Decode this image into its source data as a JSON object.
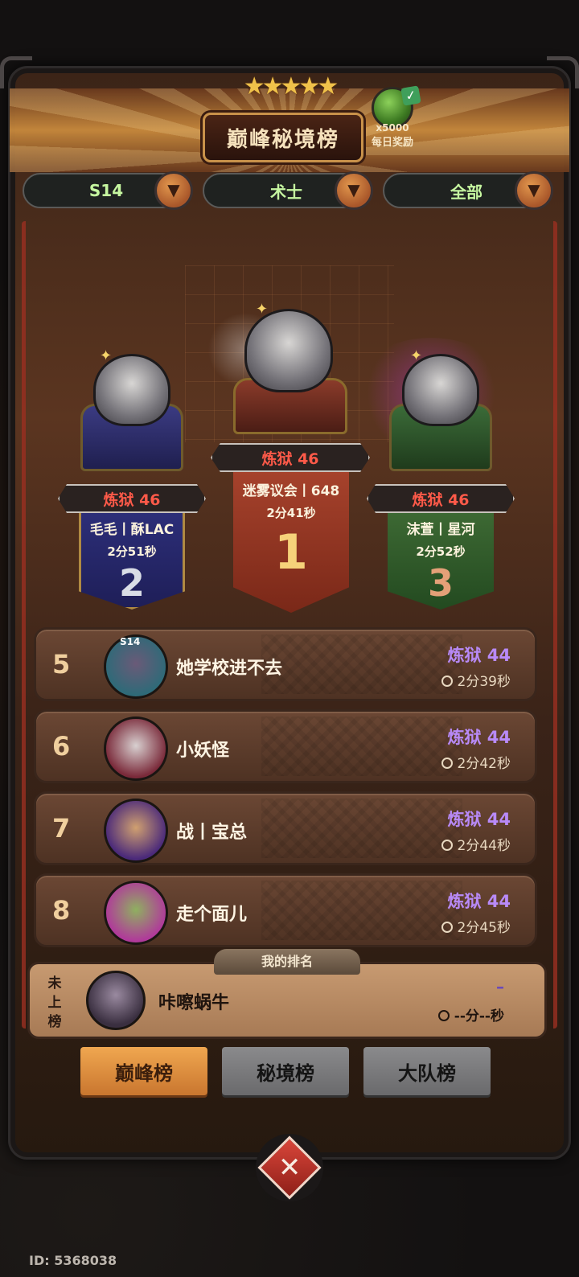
{
  "header": {
    "title": "巅峰秘境榜",
    "stars": "★★★★★",
    "reward_count": "x5000",
    "reward_label": "每日奖励",
    "reward_check": "✓"
  },
  "filters": [
    {
      "value": "S14",
      "arrow": "▼"
    },
    {
      "value": "术士",
      "arrow": "▼"
    },
    {
      "value": "全部",
      "arrow": "▼"
    }
  ],
  "podium": {
    "first": {
      "rank": "1",
      "difficulty": "炼狱 46",
      "names": "迷雾议会丨648",
      "time": "2分41秒"
    },
    "second": {
      "rank": "2",
      "difficulty": "炼狱 46",
      "names": "毛毛丨酥LAC",
      "time": "2分51秒"
    },
    "third": {
      "rank": "3",
      "difficulty": "炼狱 46",
      "names": "沫萱丨星河",
      "time": "2分52秒"
    }
  },
  "rows": [
    {
      "rank": "5",
      "name": "她学校进不去",
      "difficulty": "炼狱 44",
      "time": "2分39秒",
      "season_tag": "S14",
      "avatar_color": "#2f6a78"
    },
    {
      "rank": "6",
      "name": "小妖怪",
      "difficulty": "炼狱 44",
      "time": "2分42秒",
      "avatar_color": "#7a2a3a"
    },
    {
      "rank": "7",
      "name": "战丨宝总",
      "difficulty": "炼狱 44",
      "time": "2分44秒",
      "avatar_color": "#4b2a7a"
    },
    {
      "rank": "8",
      "name": "走个面儿",
      "difficulty": "炼狱 44",
      "time": "2分45秒",
      "avatar_color": "#b03a9a"
    }
  ],
  "my_rank": {
    "tab_label": "我的排名",
    "status": "未上榜",
    "name": "咔嚓蜗牛",
    "difficulty": "–",
    "time": "--分--秒"
  },
  "bottom_tabs": [
    {
      "label": "巅峰榜",
      "active": true
    },
    {
      "label": "秘境榜",
      "active": false
    },
    {
      "label": "大队榜",
      "active": false
    }
  ],
  "close_glyph": "✕",
  "player_id": "ID: 5368038",
  "colors": {
    "accent_orange": "#e2974d",
    "difficulty_red": "#ff5a49",
    "difficulty_purple": "#b88af8",
    "filter_green": "#c6f7a0"
  }
}
